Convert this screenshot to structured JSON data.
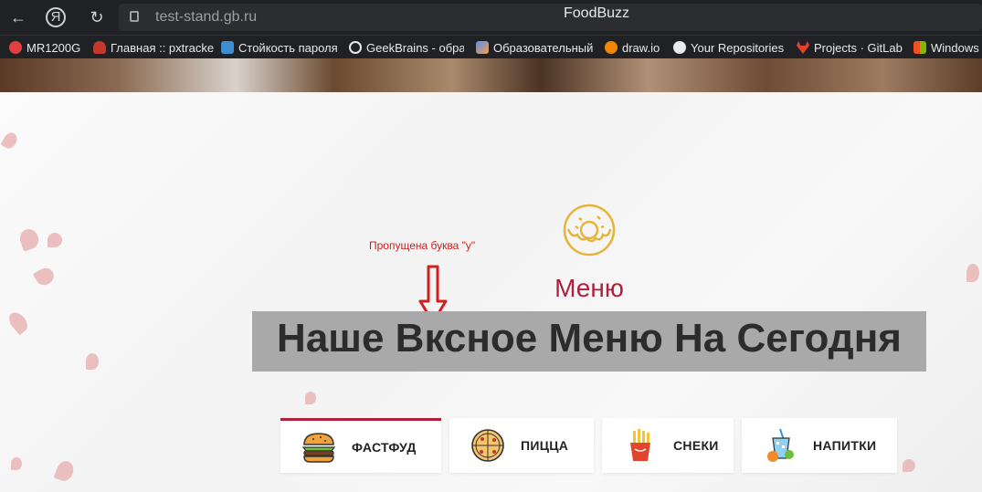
{
  "browser": {
    "url": "test-stand.gb.ru",
    "tab_title": "FoodBuzz",
    "bookmarks": [
      {
        "label": "MR1200G",
        "icon": "mr-icon",
        "color": "#e04040"
      },
      {
        "label": "Главная :: pxtracke",
        "icon": "bug-icon",
        "color": "#c0392b"
      },
      {
        "label": "Стойкость пароля",
        "icon": "ip-icon",
        "color": "#3d8fd1"
      },
      {
        "label": "GeekBrains - обра",
        "icon": "gear-icon",
        "color": "#e8eaed"
      },
      {
        "label": "Образовательный",
        "icon": "image-icon",
        "color": "#5b8def"
      },
      {
        "label": "draw.io",
        "icon": "drawio-icon",
        "color": "#f08705"
      },
      {
        "label": "Your Repositories",
        "icon": "github-icon",
        "color": "#e8eaed"
      },
      {
        "label": "Projects · GitLab",
        "icon": "gitlab-icon",
        "color": "#e24329"
      },
      {
        "label": "Windows",
        "icon": "windows-icon",
        "color": "#00a4ef"
      }
    ]
  },
  "annotation": {
    "text": "Пропущена буква \"у\"",
    "color": "#d02020"
  },
  "menu": {
    "label": "Меню",
    "headline": "Наше Вксное Меню На Сегодня",
    "accent": "#b01f3c",
    "tabs": [
      {
        "label": "ФАСТФУД",
        "icon": "burger-icon",
        "active": true
      },
      {
        "label": "ПИЦЦА",
        "icon": "pizza-icon",
        "active": false
      },
      {
        "label": "СНЕКИ",
        "icon": "fries-icon",
        "active": false
      },
      {
        "label": "НАПИТКИ",
        "icon": "drinks-icon",
        "active": false
      }
    ]
  }
}
